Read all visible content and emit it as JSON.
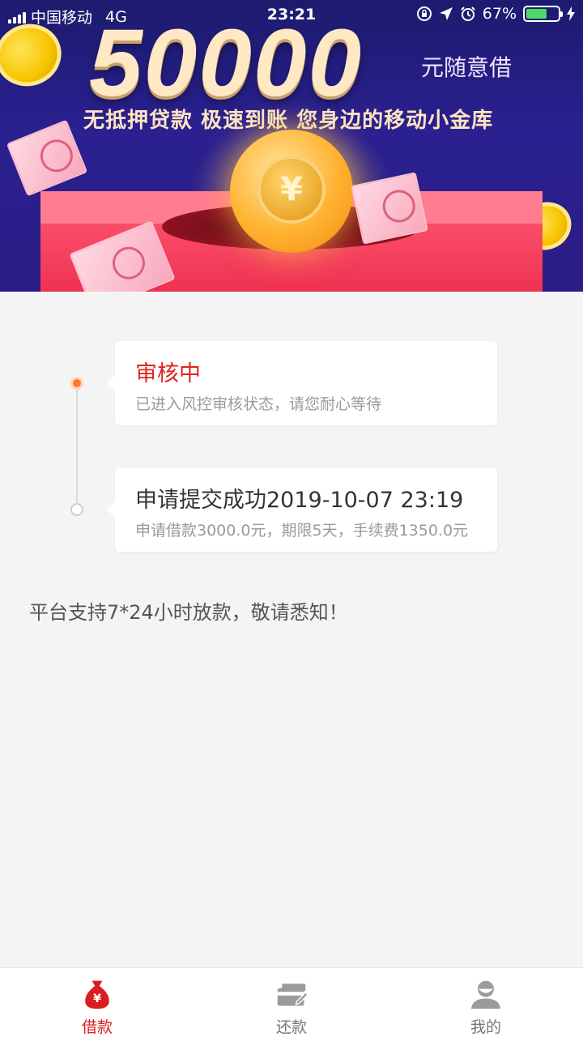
{
  "status_bar": {
    "carrier": "中国移动",
    "network": "4G",
    "time": "23:21",
    "battery_percent": "67%",
    "battery_level": 0.67
  },
  "banner": {
    "amount": "50000",
    "amount_suffix": "元随意借",
    "slogan": "无抵押贷款 极速到账  您身边的移动小金库"
  },
  "timeline": {
    "items": [
      {
        "title": "审核中",
        "description": "已进入风控审核状态，请您耐心等待",
        "state": "active",
        "title_color": "#e0241c"
      },
      {
        "title": "申请提交成功2019-10-07 23:19",
        "description": "申请借款3000.0元，期限5天，手续费1350.0元",
        "state": "done"
      }
    ]
  },
  "notice": "平台支持7*24小时放款，敬请悉知！",
  "tabbar": {
    "tabs": [
      {
        "label": "借款",
        "icon": "money-bag-icon",
        "active": true
      },
      {
        "label": "还款",
        "icon": "repay-card-icon",
        "active": false
      },
      {
        "label": "我的",
        "icon": "user-icon",
        "active": false
      }
    ],
    "active_color": "#d81e1e",
    "inactive_color": "#777777"
  }
}
